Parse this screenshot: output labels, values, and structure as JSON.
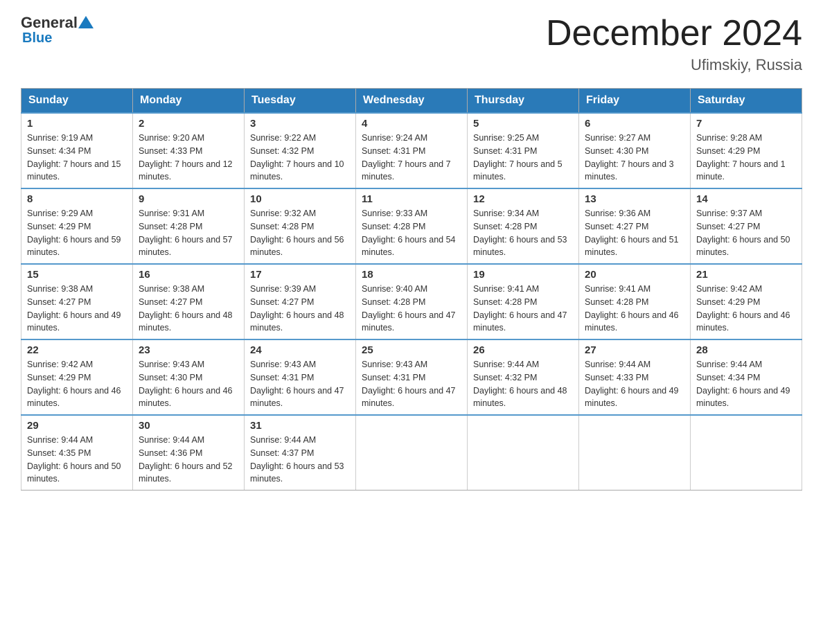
{
  "header": {
    "logo_general": "General",
    "logo_blue": "Blue",
    "month_title": "December 2024",
    "location": "Ufimskiy, Russia"
  },
  "days_of_week": [
    "Sunday",
    "Monday",
    "Tuesday",
    "Wednesday",
    "Thursday",
    "Friday",
    "Saturday"
  ],
  "weeks": [
    [
      {
        "day": "1",
        "sunrise": "Sunrise: 9:19 AM",
        "sunset": "Sunset: 4:34 PM",
        "daylight": "Daylight: 7 hours and 15 minutes."
      },
      {
        "day": "2",
        "sunrise": "Sunrise: 9:20 AM",
        "sunset": "Sunset: 4:33 PM",
        "daylight": "Daylight: 7 hours and 12 minutes."
      },
      {
        "day": "3",
        "sunrise": "Sunrise: 9:22 AM",
        "sunset": "Sunset: 4:32 PM",
        "daylight": "Daylight: 7 hours and 10 minutes."
      },
      {
        "day": "4",
        "sunrise": "Sunrise: 9:24 AM",
        "sunset": "Sunset: 4:31 PM",
        "daylight": "Daylight: 7 hours and 7 minutes."
      },
      {
        "day": "5",
        "sunrise": "Sunrise: 9:25 AM",
        "sunset": "Sunset: 4:31 PM",
        "daylight": "Daylight: 7 hours and 5 minutes."
      },
      {
        "day": "6",
        "sunrise": "Sunrise: 9:27 AM",
        "sunset": "Sunset: 4:30 PM",
        "daylight": "Daylight: 7 hours and 3 minutes."
      },
      {
        "day": "7",
        "sunrise": "Sunrise: 9:28 AM",
        "sunset": "Sunset: 4:29 PM",
        "daylight": "Daylight: 7 hours and 1 minute."
      }
    ],
    [
      {
        "day": "8",
        "sunrise": "Sunrise: 9:29 AM",
        "sunset": "Sunset: 4:29 PM",
        "daylight": "Daylight: 6 hours and 59 minutes."
      },
      {
        "day": "9",
        "sunrise": "Sunrise: 9:31 AM",
        "sunset": "Sunset: 4:28 PM",
        "daylight": "Daylight: 6 hours and 57 minutes."
      },
      {
        "day": "10",
        "sunrise": "Sunrise: 9:32 AM",
        "sunset": "Sunset: 4:28 PM",
        "daylight": "Daylight: 6 hours and 56 minutes."
      },
      {
        "day": "11",
        "sunrise": "Sunrise: 9:33 AM",
        "sunset": "Sunset: 4:28 PM",
        "daylight": "Daylight: 6 hours and 54 minutes."
      },
      {
        "day": "12",
        "sunrise": "Sunrise: 9:34 AM",
        "sunset": "Sunset: 4:28 PM",
        "daylight": "Daylight: 6 hours and 53 minutes."
      },
      {
        "day": "13",
        "sunrise": "Sunrise: 9:36 AM",
        "sunset": "Sunset: 4:27 PM",
        "daylight": "Daylight: 6 hours and 51 minutes."
      },
      {
        "day": "14",
        "sunrise": "Sunrise: 9:37 AM",
        "sunset": "Sunset: 4:27 PM",
        "daylight": "Daylight: 6 hours and 50 minutes."
      }
    ],
    [
      {
        "day": "15",
        "sunrise": "Sunrise: 9:38 AM",
        "sunset": "Sunset: 4:27 PM",
        "daylight": "Daylight: 6 hours and 49 minutes."
      },
      {
        "day": "16",
        "sunrise": "Sunrise: 9:38 AM",
        "sunset": "Sunset: 4:27 PM",
        "daylight": "Daylight: 6 hours and 48 minutes."
      },
      {
        "day": "17",
        "sunrise": "Sunrise: 9:39 AM",
        "sunset": "Sunset: 4:27 PM",
        "daylight": "Daylight: 6 hours and 48 minutes."
      },
      {
        "day": "18",
        "sunrise": "Sunrise: 9:40 AM",
        "sunset": "Sunset: 4:28 PM",
        "daylight": "Daylight: 6 hours and 47 minutes."
      },
      {
        "day": "19",
        "sunrise": "Sunrise: 9:41 AM",
        "sunset": "Sunset: 4:28 PM",
        "daylight": "Daylight: 6 hours and 47 minutes."
      },
      {
        "day": "20",
        "sunrise": "Sunrise: 9:41 AM",
        "sunset": "Sunset: 4:28 PM",
        "daylight": "Daylight: 6 hours and 46 minutes."
      },
      {
        "day": "21",
        "sunrise": "Sunrise: 9:42 AM",
        "sunset": "Sunset: 4:29 PM",
        "daylight": "Daylight: 6 hours and 46 minutes."
      }
    ],
    [
      {
        "day": "22",
        "sunrise": "Sunrise: 9:42 AM",
        "sunset": "Sunset: 4:29 PM",
        "daylight": "Daylight: 6 hours and 46 minutes."
      },
      {
        "day": "23",
        "sunrise": "Sunrise: 9:43 AM",
        "sunset": "Sunset: 4:30 PM",
        "daylight": "Daylight: 6 hours and 46 minutes."
      },
      {
        "day": "24",
        "sunrise": "Sunrise: 9:43 AM",
        "sunset": "Sunset: 4:31 PM",
        "daylight": "Daylight: 6 hours and 47 minutes."
      },
      {
        "day": "25",
        "sunrise": "Sunrise: 9:43 AM",
        "sunset": "Sunset: 4:31 PM",
        "daylight": "Daylight: 6 hours and 47 minutes."
      },
      {
        "day": "26",
        "sunrise": "Sunrise: 9:44 AM",
        "sunset": "Sunset: 4:32 PM",
        "daylight": "Daylight: 6 hours and 48 minutes."
      },
      {
        "day": "27",
        "sunrise": "Sunrise: 9:44 AM",
        "sunset": "Sunset: 4:33 PM",
        "daylight": "Daylight: 6 hours and 49 minutes."
      },
      {
        "day": "28",
        "sunrise": "Sunrise: 9:44 AM",
        "sunset": "Sunset: 4:34 PM",
        "daylight": "Daylight: 6 hours and 49 minutes."
      }
    ],
    [
      {
        "day": "29",
        "sunrise": "Sunrise: 9:44 AM",
        "sunset": "Sunset: 4:35 PM",
        "daylight": "Daylight: 6 hours and 50 minutes."
      },
      {
        "day": "30",
        "sunrise": "Sunrise: 9:44 AM",
        "sunset": "Sunset: 4:36 PM",
        "daylight": "Daylight: 6 hours and 52 minutes."
      },
      {
        "day": "31",
        "sunrise": "Sunrise: 9:44 AM",
        "sunset": "Sunset: 4:37 PM",
        "daylight": "Daylight: 6 hours and 53 minutes."
      },
      null,
      null,
      null,
      null
    ]
  ]
}
